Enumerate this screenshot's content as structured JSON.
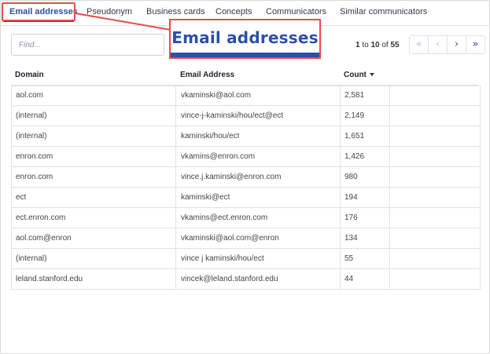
{
  "tabs": [
    {
      "label": "Email addresses",
      "active": true
    },
    {
      "label": "Pseudonym",
      "active": false
    },
    {
      "label": "Business cards",
      "active": false
    },
    {
      "label": "Concepts",
      "active": false
    },
    {
      "label": "Communicators",
      "active": false
    },
    {
      "label": "Similar communicators",
      "active": false
    }
  ],
  "callout": {
    "label": "Email addresses"
  },
  "search": {
    "placeholder": "Find..."
  },
  "pagination": {
    "start": "1",
    "to": "to",
    "end": "10",
    "of": "of",
    "total": "55"
  },
  "table": {
    "columns": [
      "Domain",
      "Email Address",
      "Count"
    ],
    "rows": [
      {
        "domain": "aol.com",
        "email": "vkaminski@aol.com",
        "count": "2,581"
      },
      {
        "domain": "(internal)",
        "email": "vince-j-kaminski/hou/ect@ect",
        "count": "2,149"
      },
      {
        "domain": "(internal)",
        "email": "kaminski/hou/ect",
        "count": "1,651"
      },
      {
        "domain": "enron.com",
        "email": "vkamins@enron.com",
        "count": "1,426"
      },
      {
        "domain": "enron.com",
        "email": "vince.j.kaminski@enron.com",
        "count": "980"
      },
      {
        "domain": "ect",
        "email": "kaminski@ect",
        "count": "194"
      },
      {
        "domain": "ect.enron.com",
        "email": "vkamins@ect.enron.com",
        "count": "176"
      },
      {
        "domain": "aol.com@enron",
        "email": "vkaminski@aol.com@enron",
        "count": "134"
      },
      {
        "domain": "(internal)",
        "email": "vince j kaminski/hou/ect",
        "count": "55"
      },
      {
        "domain": "leland.stanford.edu",
        "email": "vincek@leland.stanford.edu",
        "count": "44"
      }
    ]
  },
  "colors": {
    "accent": "#2c4fa8",
    "highlight": "#e74c4c"
  }
}
